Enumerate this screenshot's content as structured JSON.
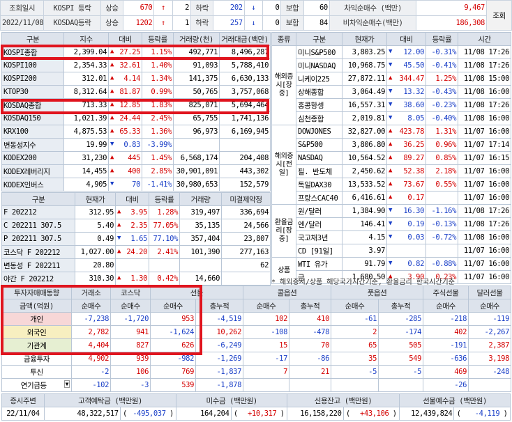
{
  "top": {
    "r1": [
      "조회일시",
      "KOSPI 등락",
      "상승",
      "670",
      "↑",
      "2",
      "하락",
      "202",
      "↓",
      "0",
      "보합",
      "60",
      "차익순매수 (백만)",
      "9,467"
    ],
    "r2": [
      "2022/11/08",
      "KOSDAQ등락",
      "상승",
      "1202",
      "↑",
      "1",
      "하락",
      "257",
      "↓",
      "0",
      "보합",
      "84",
      "비차익순매수(백만)",
      "186,308"
    ],
    "btn": "조회"
  },
  "idx": {
    "headers": [
      "구분",
      "지수",
      "대비",
      "등락률",
      "거래량(천)",
      "거래대금(백만)"
    ],
    "rows": [
      [
        "KOSPI종합",
        "2,399.04",
        "up",
        "27.25",
        "1.15%",
        "492,771",
        "8,496,287"
      ],
      [
        "KOSPI100",
        "2,354.33",
        "up",
        "32.61",
        "1.40%",
        "91,093",
        "5,788,410"
      ],
      [
        "KOSPI200",
        "312.01",
        "up",
        "4.14",
        "1.34%",
        "141,375",
        "6,630,133"
      ],
      [
        "KTOP30",
        "8,312.64",
        "up",
        "81.87",
        "0.99%",
        "50,765",
        "3,757,068"
      ],
      [
        "KOSDAQ종합",
        "713.33",
        "up",
        "12.85",
        "1.83%",
        "825,071",
        "5,694,464"
      ],
      [
        "KOSDAQ150",
        "1,021.39",
        "up",
        "24.44",
        "2.45%",
        "65,755",
        "1,741,136"
      ],
      [
        "KRX100",
        "4,875.53",
        "up",
        "65.33",
        "1.36%",
        "96,973",
        "6,169,945"
      ],
      [
        "변동성지수",
        "19.99",
        "dn",
        "0.83",
        "-3.99%",
        "",
        ""
      ],
      [
        "KODEX200",
        "31,230",
        "up",
        "445",
        "1.45%",
        "6,568,174",
        "204,408"
      ],
      [
        "KODEX레버리지",
        "14,455",
        "up",
        "400",
        "2.85%",
        "30,901,091",
        "443,302"
      ],
      [
        "KODEX인버스",
        "4,905",
        "dn",
        "70",
        "-1.41%",
        "30,980,653",
        "152,579"
      ]
    ]
  },
  "fut": {
    "headers": [
      "구분",
      "현재가",
      "대비",
      "등락률",
      "거래량",
      "미결제약정"
    ],
    "rows": [
      [
        "F 202212",
        "312.95",
        "up",
        "3.95",
        "1.28%",
        "319,497",
        "336,694"
      ],
      [
        "C 202211 307.5",
        "5.40",
        "up",
        "2.35",
        "77.05%",
        "35,135",
        "24,566"
      ],
      [
        "P 202211 307.5",
        "0.49",
        "dn",
        "1.65",
        "77.10%",
        "357,404",
        "23,807"
      ],
      [
        "코스닥 F 202212",
        "1,027.00",
        "up",
        "24.20",
        "2.41%",
        "101,390",
        "277,163"
      ],
      [
        "변동성 F 202211",
        "20.80",
        "",
        "",
        "",
        "",
        "62"
      ],
      [
        "야간 F 202212",
        "310.30",
        "up",
        "1.30",
        "0.42%",
        "14,660",
        ""
      ]
    ]
  },
  "world": {
    "headers": [
      "종류",
      "구분",
      "현재가",
      "대비",
      "등락률",
      "시간"
    ],
    "groups": [
      {
        "label": "해외증시[장중]",
        "rows": [
          [
            "미니S&P500",
            "3,803.25",
            "dn",
            "12.00",
            "-0.31%",
            "11/08 17:26"
          ],
          [
            "미니NASDAQ",
            "10,968.75",
            "dn",
            "45.50",
            "-0.41%",
            "11/08 17:26"
          ],
          [
            "니케이225",
            "27,872.11",
            "up",
            "344.47",
            "1.25%",
            "11/08 15:00"
          ],
          [
            "상해종합",
            "3,064.49",
            "dn",
            "13.32",
            "-0.43%",
            "11/08 16:00"
          ],
          [
            "홍콩항셍",
            "16,557.31",
            "dn",
            "38.60",
            "-0.23%",
            "11/08 17:26"
          ],
          [
            "심천종합",
            "2,019.81",
            "dn",
            "8.05",
            "-0.40%",
            "11/08 16:00"
          ]
        ]
      },
      {
        "label": "해외증시[전일]",
        "rows": [
          [
            "DOWJONES",
            "32,827.00",
            "up",
            "423.78",
            "1.31%",
            "11/07 16:00"
          ],
          [
            "S&P500",
            "3,806.80",
            "up",
            "36.25",
            "0.96%",
            "11/07 17:14"
          ],
          [
            "NASDAQ",
            "10,564.52",
            "up",
            "89.27",
            "0.85%",
            "11/07 16:15"
          ],
          [
            "필. 반도체",
            "2,450.62",
            "up",
            "52.38",
            "2.18%",
            "11/07 16:00"
          ],
          [
            "독일DAX30",
            "13,533.52",
            "up",
            "73.67",
            "0.55%",
            "11/07 16:00"
          ],
          [
            "프랑스CAC40",
            "6,416.61",
            "up",
            "0.17",
            "",
            "11/07 16:00"
          ]
        ]
      },
      {
        "label": "환율금리[장중]",
        "rows": [
          [
            "원/달러",
            "1,384.90",
            "dn",
            "16.30",
            "-1.16%",
            "11/08 17:26"
          ],
          [
            "엔/달러",
            "146.41",
            "dn",
            "0.19",
            "-0.13%",
            "11/08 17:26"
          ],
          [
            "국고채3년",
            "4.15",
            "dn",
            "0.03",
            "-0.72%",
            "11/08 16:00"
          ],
          [
            "CD [91일]",
            "3.97",
            "",
            "",
            "",
            "11/07 16:00"
          ]
        ]
      },
      {
        "label": "상품",
        "rows": [
          [
            "WTI 유가",
            "91.79",
            "dn",
            "0.82",
            "-0.88%",
            "11/07 16:00"
          ],
          [
            "금",
            "1,680.50",
            "up",
            "3.90",
            "0.23%",
            "11/07 16:00"
          ]
        ]
      }
    ],
    "note": "* 해외증시/상품 해당국가시간기준, 환율금리 한국시간기준"
  },
  "inv": {
    "h1": [
      "투자자매매동향",
      "거래소",
      "코스닥",
      "선물",
      "",
      "콜옵션",
      "",
      "풋옵션",
      "",
      "주식선물",
      "달러선물"
    ],
    "h2": [
      "금액(억원)",
      "순매수",
      "순매수",
      "순매수",
      "총누적",
      "순매수",
      "총누적",
      "순매수",
      "총누적",
      "순매수",
      "순매수"
    ],
    "rows": [
      [
        "개인",
        "-7,238",
        "-1,720",
        "953",
        "-4,519",
        "102",
        "410",
        "-61",
        "-285",
        "-218",
        "-119"
      ],
      [
        "외국인",
        "2,782",
        "941",
        "-1,624",
        "10,262",
        "-108",
        "-478",
        "2",
        "-174",
        "402",
        "-2,267"
      ],
      [
        "기관계",
        "4,404",
        "827",
        "626",
        "-6,249",
        "15",
        "70",
        "65",
        "505",
        "-191",
        "2,387"
      ],
      [
        "금융투자",
        "4,902",
        "939",
        "-982",
        "-1,269",
        "-17",
        "-86",
        "35",
        "549",
        "-636",
        "3,198"
      ],
      [
        "투신",
        "-2",
        "106",
        "769",
        "-1,837",
        "7",
        "21",
        "-5",
        "-5",
        "469",
        "-248"
      ],
      [
        "연기금등",
        "-102",
        "-3",
        "539",
        "-1,878",
        "",
        "",
        "",
        "",
        "-26",
        ""
      ]
    ]
  },
  "bottom": {
    "headers": [
      "증시주변",
      "고객예탁금 (백만원)",
      "미수금 (백만원)",
      "신용잔고 (백만원)",
      "선물예수금 (백만원)"
    ],
    "row": [
      "22/11/04",
      "48,322,517",
      "(",
      "-495,037",
      ")",
      "164,204",
      "(",
      "+10,317",
      ")",
      "16,158,220",
      "(",
      "+43,106",
      ")",
      "12,439,824",
      "(",
      "-4,119",
      ")"
    ]
  },
  "colors": {
    "up": "#d40000",
    "down": "#1a3fc8",
    "highlight": "#e0141e"
  }
}
